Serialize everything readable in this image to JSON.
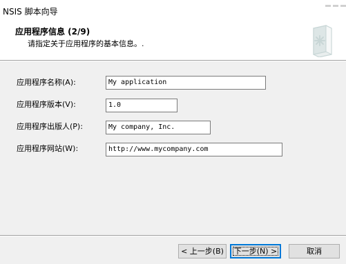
{
  "window": {
    "title": "NSIS 脚本向导"
  },
  "header": {
    "title": "应用程序信息 (2/9)",
    "subtitle": "请指定关于应用程序的基本信息。."
  },
  "icons": {
    "header": "script-document-icon"
  },
  "fields": {
    "app_name": {
      "label": "应用程序名称(A):",
      "value": "My application"
    },
    "app_version": {
      "label": "应用程序版本(V):",
      "value": "1.0"
    },
    "app_publisher": {
      "label": "应用程序出版人(P):",
      "value": "My company, Inc."
    },
    "app_website": {
      "label": "应用程序网站(W):",
      "value": "http://www.mycompany.com"
    }
  },
  "buttons": {
    "back": "< 上一步(B)",
    "next": "下一步(N) >",
    "cancel": "取消"
  },
  "colors": {
    "accent": "#0078d7",
    "icon_tint": "#c8d6d6"
  }
}
